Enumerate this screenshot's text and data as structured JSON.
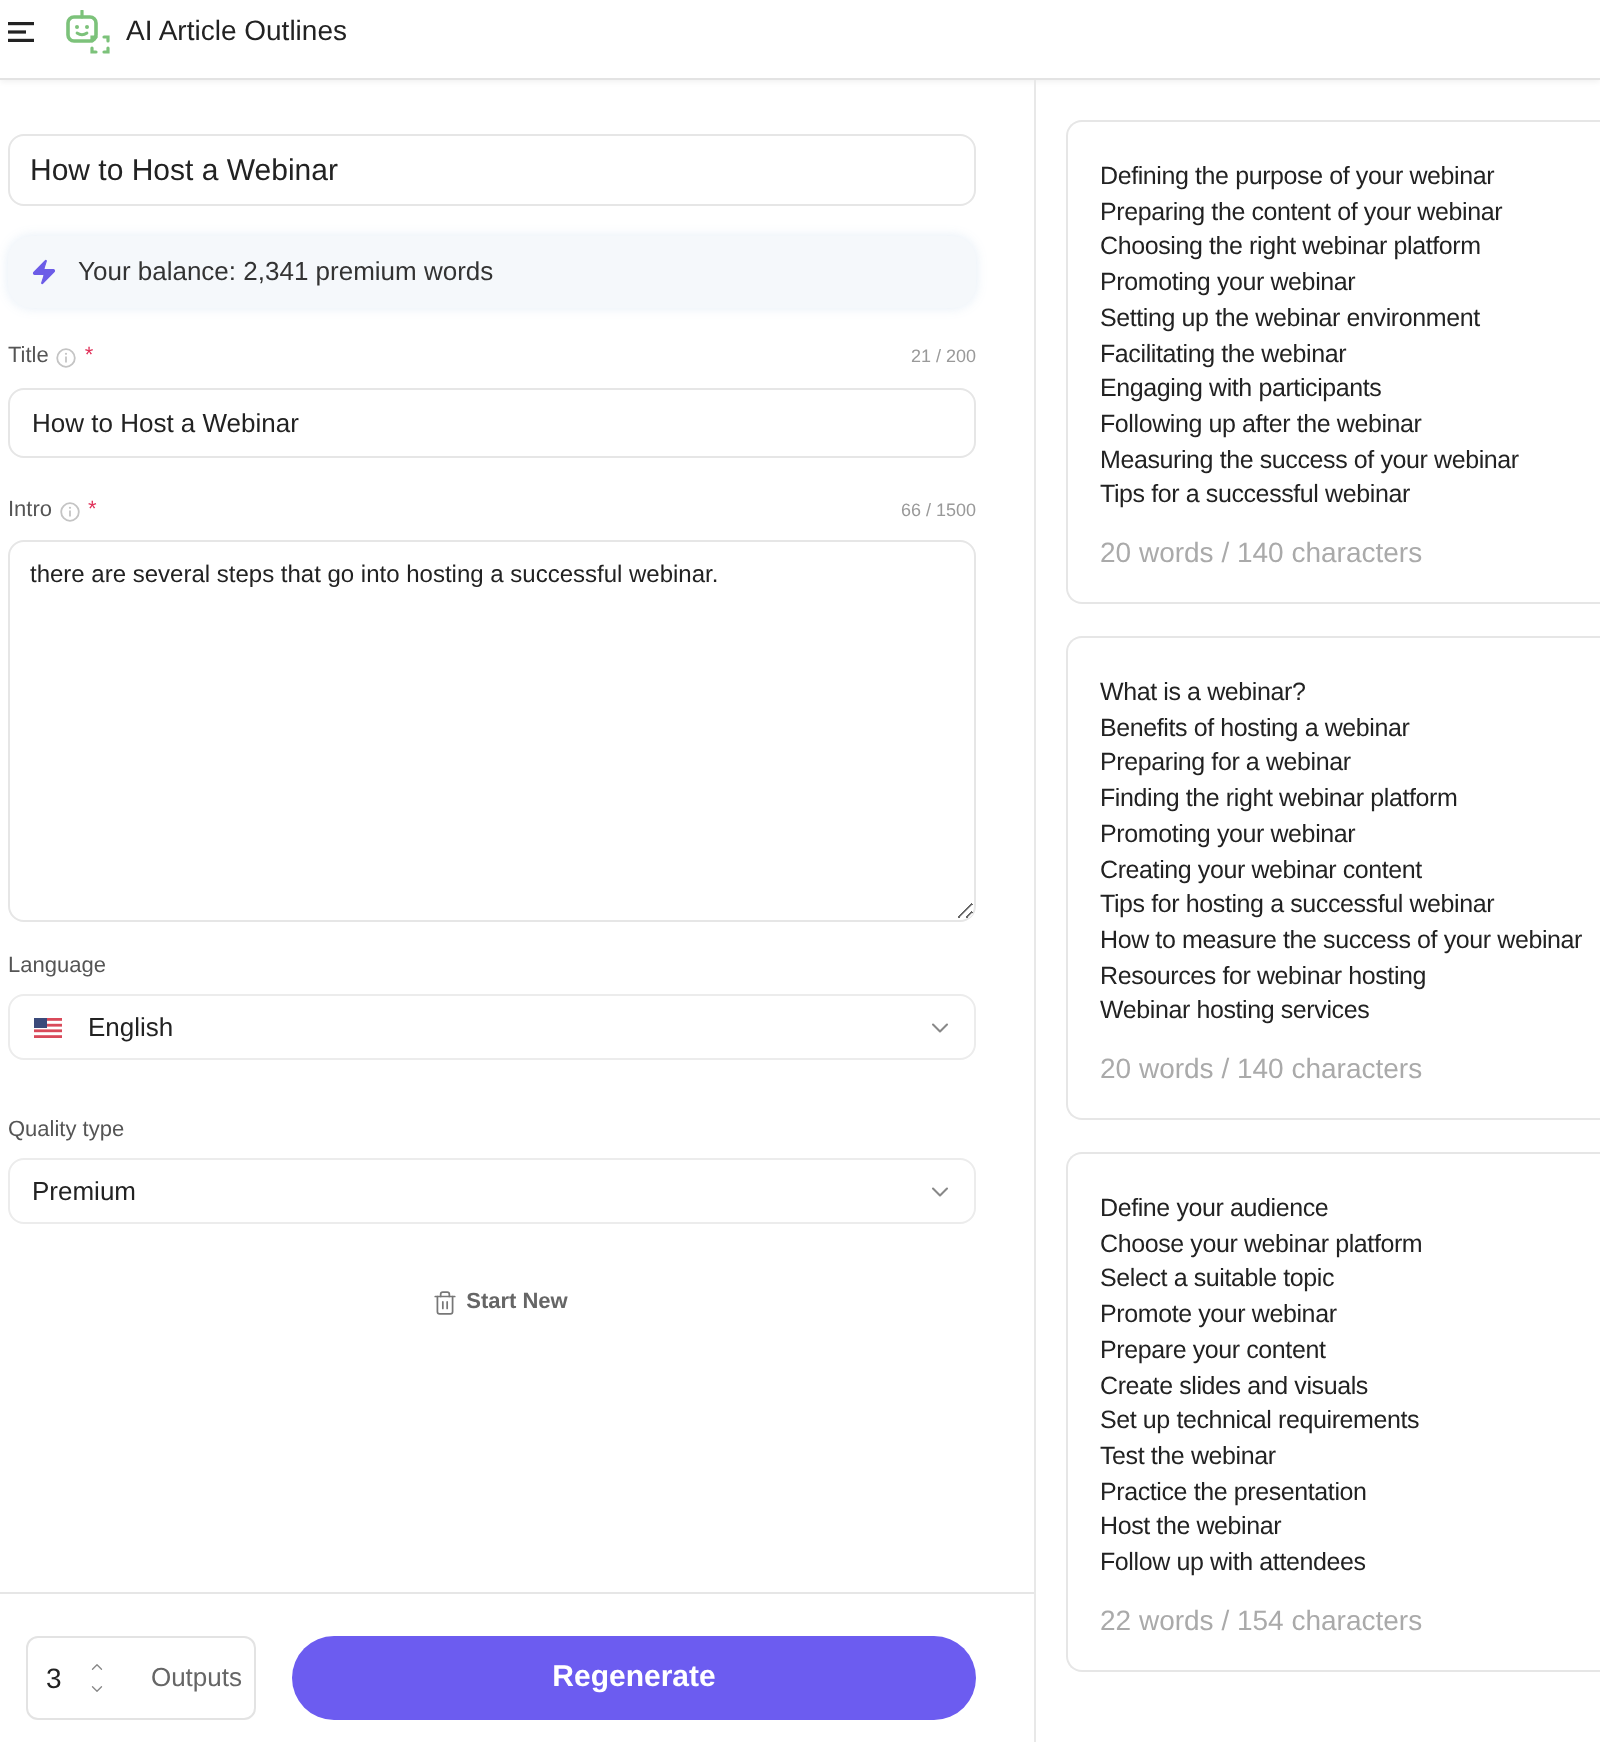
{
  "header": {
    "title": "AI Article Outlines"
  },
  "form": {
    "topic": {
      "value": "How to Host a Webinar"
    },
    "balance": {
      "text": "Your balance: 2,341 premium words"
    },
    "fields": [
      {
        "kind": "input",
        "label": "Title",
        "required_mark": "*",
        "counter": "21 / 200",
        "value": "How to Host a Webinar"
      },
      {
        "kind": "textarea",
        "label": "Intro",
        "required_mark": "*",
        "counter": "66 / 1500",
        "value": "there are several steps that go into hosting a successful webinar."
      }
    ],
    "selects": [
      {
        "kind": "language",
        "label": "Language",
        "value": "English"
      },
      {
        "kind": "plain",
        "label": "Quality type",
        "value": "Premium"
      }
    ],
    "start_new": "Start New"
  },
  "footer": {
    "outputs": {
      "value": "3",
      "label": "Outputs"
    },
    "button": "Regenerate"
  },
  "results": [
    {
      "lines": [
        "Defining the purpose of your webinar",
        "Preparing the content of your webinar",
        "Choosing the right webinar platform",
        "Promoting your webinar",
        "Setting up the webinar environment",
        "Facilitating the webinar",
        "Engaging with participants",
        "Following up after the webinar",
        "Measuring the success of your webinar",
        "Tips for a successful webinar"
      ],
      "stats": "20 words / 140 characters"
    },
    {
      "lines": [
        "What is a webinar?",
        "Benefits of hosting a webinar",
        "Preparing for a webinar",
        "Finding the right webinar platform",
        "Promoting your webinar",
        "Creating your webinar content",
        "Tips for hosting a successful webinar",
        "How to measure the success of your webinar",
        "Resources for webinar hosting",
        "Webinar hosting services"
      ],
      "stats": "20 words / 140 characters"
    },
    {
      "lines": [
        "Define your audience",
        "Choose your webinar platform",
        "Select a suitable topic",
        "Promote your webinar",
        "Prepare your content",
        "Create slides and visuals",
        "Set up technical requirements",
        "Test the webinar",
        "Practice the presentation",
        "Host the webinar",
        "Follow up with attendees"
      ],
      "stats": "22 words / 154 characters"
    }
  ]
}
